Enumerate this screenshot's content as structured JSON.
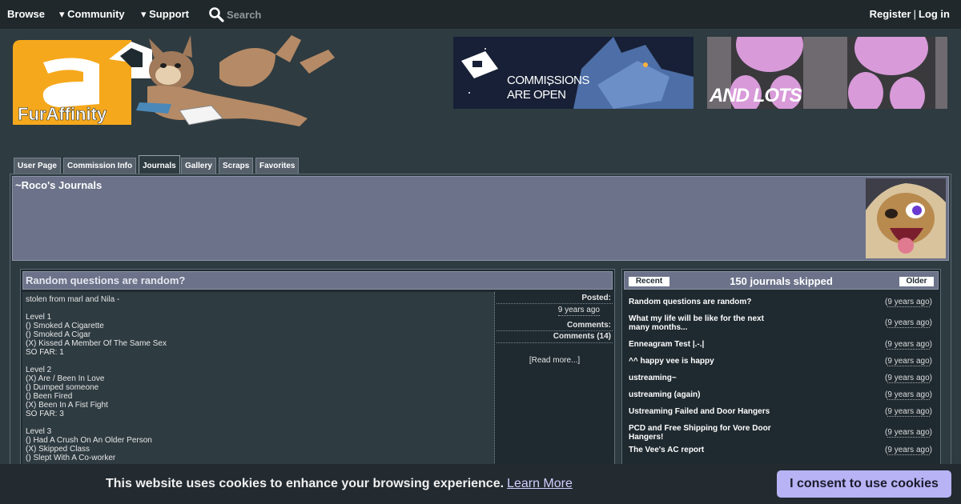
{
  "nav": {
    "browse": "Browse",
    "community": "▾ Community",
    "support": "▾ Support",
    "search_placeholder": "Search",
    "register": "Register",
    "separator": "|",
    "login": "Log in"
  },
  "banners": {
    "commissions_line1": "COMMISSIONS",
    "commissions_line2": "ARE OPEN",
    "and_lots": "AND LOTS"
  },
  "logo": {
    "text": "FurAffinity"
  },
  "tabs": [
    "User Page",
    "Commission Info",
    "Journals",
    "Gallery",
    "Scraps",
    "Favorites"
  ],
  "active_tab": "Journals",
  "profile": {
    "title": "~Roco's Journals"
  },
  "journal": {
    "title": "Random questions are random?",
    "body": [
      "stolen from marl and Nila -",
      "",
      "Level 1",
      "() Smoked A Cigarette",
      "() Smoked A Cigar",
      "(X) Kissed A Member Of The Same Sex",
      "SO FAR: 1",
      "",
      "Level 2",
      "(X) Are / Been In Love",
      "() Dumped someone",
      "() Been Fired",
      "(X) Been In A Fist Fight",
      "SO FAR: 3",
      "",
      "Level 3",
      "() Had A Crush On An Older Person",
      "(X) Skipped Class",
      "() Slept With A Co-worker"
    ],
    "posted_label": "Posted:",
    "posted_value": "9 years ago",
    "comments_label": "Comments:",
    "comments_value": "Comments (14)",
    "read_more": "[Read more...]"
  },
  "journal_list": {
    "recent_label": "Recent",
    "skipped_text": "150 journals skipped",
    "older_label": "Older",
    "items": [
      {
        "title": "Random questions are random?",
        "ago": "9 years ago"
      },
      {
        "title": "What my life will be like for the next many months...",
        "ago": "9 years ago"
      },
      {
        "title": "Enneagram Test |.-.|",
        "ago": "9 years ago"
      },
      {
        "title": "^^ happy vee is happy",
        "ago": "9 years ago"
      },
      {
        "title": "ustreaming~",
        "ago": "9 years ago"
      },
      {
        "title": "ustreaming (again)",
        "ago": "9 years ago"
      },
      {
        "title": "Ustreaming Failed and Door Hangers",
        "ago": "9 years ago"
      },
      {
        "title": "PCD and Free Shipping for Vore Door Hangers!",
        "ago": "9 years ago"
      },
      {
        "title": "The Vee's AC report",
        "ago": "9 years ago"
      }
    ]
  },
  "cookie": {
    "text": "This website uses cookies to enhance your browsing experience.",
    "learn_more": "Learn More",
    "consent": "I consent to use cookies"
  }
}
